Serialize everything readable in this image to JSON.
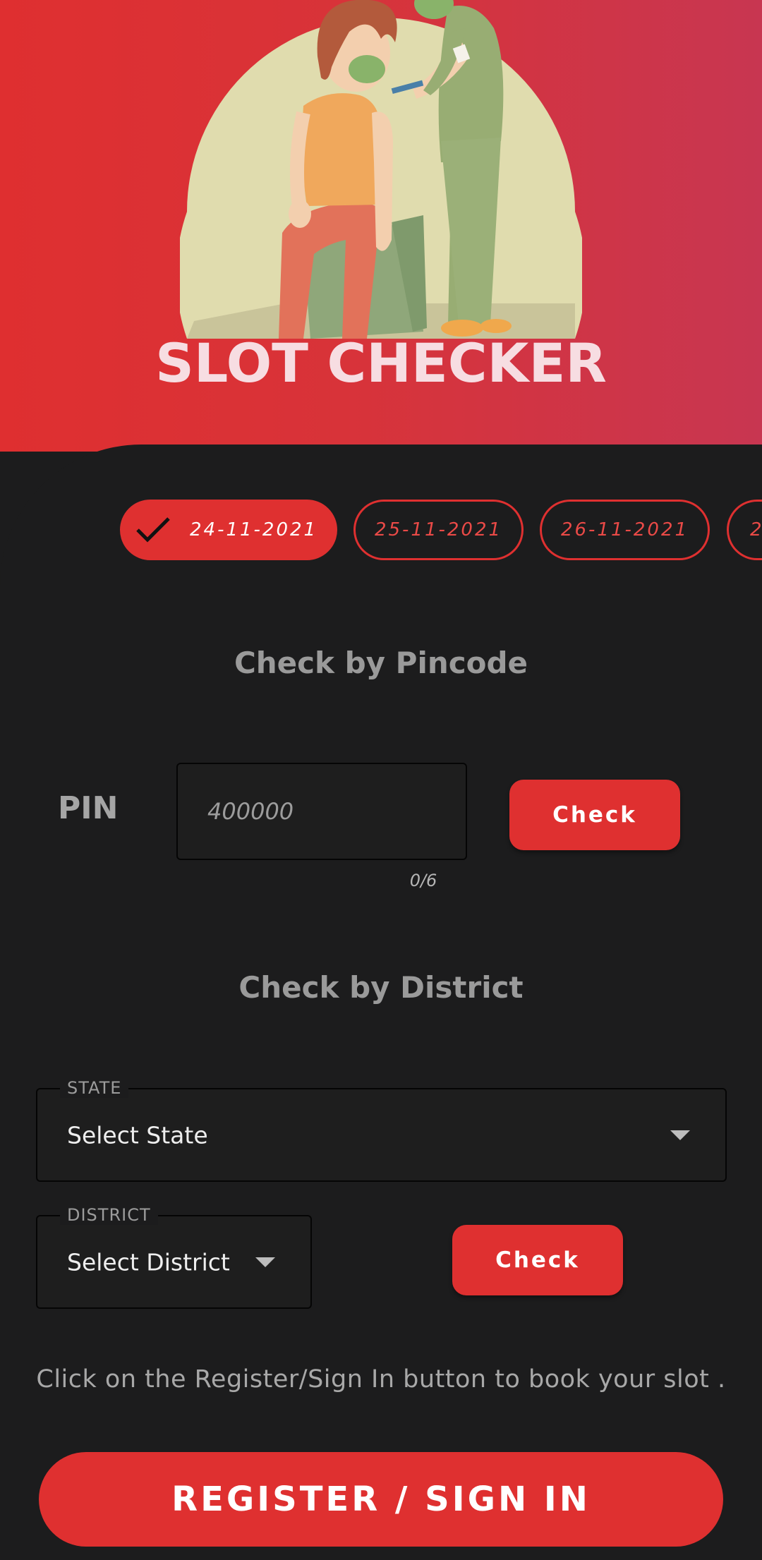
{
  "hero": {
    "title": "SLOT CHECKER",
    "illustration": "vaccination-illustration"
  },
  "dates": [
    {
      "label": "24-11-2021",
      "selected": true
    },
    {
      "label": "25-11-2021",
      "selected": false
    },
    {
      "label": "26-11-2021",
      "selected": false
    },
    {
      "label": "2",
      "selected": false
    }
  ],
  "pincode": {
    "heading": "Check by Pincode",
    "label": "PIN",
    "placeholder": "400000",
    "counter": "0/6",
    "button": "Check"
  },
  "district": {
    "heading": "Check by District",
    "state_legend": "STATE",
    "state_value": "Select State",
    "district_legend": "DISTRICT",
    "district_value": "Select District",
    "button": "Check"
  },
  "footer": {
    "info": "Click on the Register/Sign In button to book your slot .",
    "register_button": "REGISTER / SIGN IN"
  },
  "colors": {
    "accent": "#df3030",
    "hero_gradient_start": "#df2f30",
    "hero_gradient_end": "#c83651",
    "background": "#1c1c1d"
  },
  "icons": {
    "selected_date": "check-icon",
    "dropdown": "caret-down-icon"
  }
}
